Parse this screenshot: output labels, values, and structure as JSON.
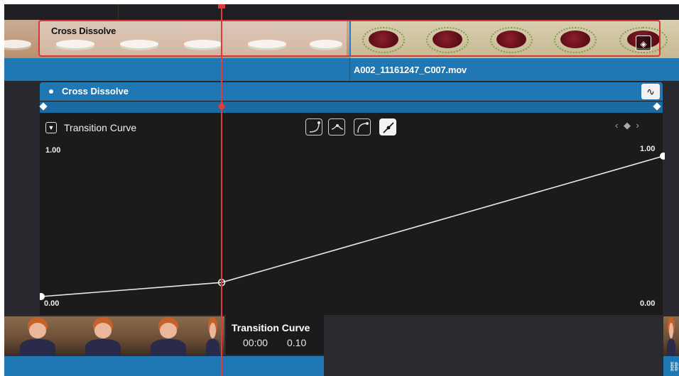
{
  "timeline": {
    "transition_label": "Cross Dissolve",
    "clip_name": "A002_11161247_C007.mov"
  },
  "inspector": {
    "transition_title": "Cross Dissolve",
    "curve_panel_label": "Transition Curve",
    "presets": [
      "ease-in-icon",
      "ease-in-out-icon",
      "ease-out-icon",
      "linear-icon"
    ],
    "nav_glyphs": "‹ ◆ ›"
  },
  "graph": {
    "y_top_left": "1.00",
    "y_top_right": "1.00",
    "y_bottom_left": "0.00",
    "y_bottom_right": "0.00",
    "curve_points": [
      {
        "time": 0.0,
        "value": 0.0
      },
      {
        "time": 0.29,
        "value": 0.1
      },
      {
        "time": 1.0,
        "value": 1.0
      }
    ]
  },
  "tooltip": {
    "title": "Transition Curve",
    "time": "00:00",
    "value": "0.10"
  },
  "colors": {
    "accent_blue": "#1f78b4",
    "playhead_red": "#e23b3b",
    "panel_bg": "#1c1a1b"
  }
}
